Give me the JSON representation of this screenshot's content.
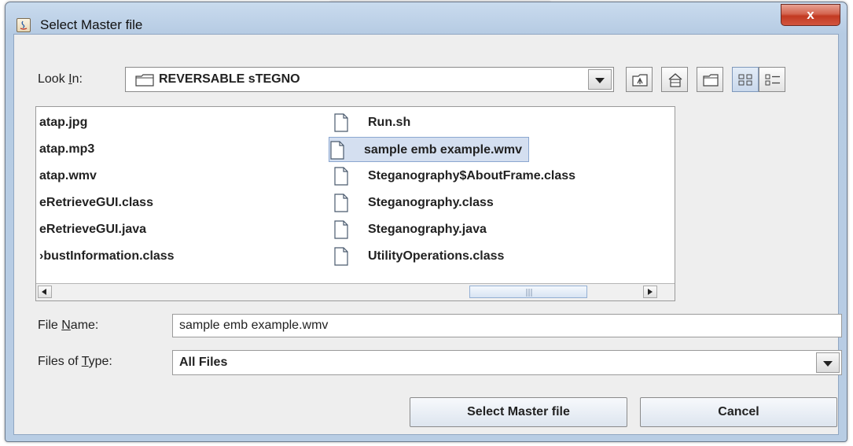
{
  "window": {
    "title": "Select Master file",
    "close_label": "x"
  },
  "look_in": {
    "label_pre": "Look ",
    "label_mnemonic": "I",
    "label_post": "n:",
    "value": "REVERSABLE sTEGNO"
  },
  "toolbar": {
    "buttons": [
      "up-one-level",
      "home",
      "new-folder",
      "list-view",
      "details-view"
    ]
  },
  "files": {
    "left_column": [
      "atap.jpg",
      "atap.mp3",
      "atap.wmv",
      "eRetrieveGUI.class",
      "eRetrieveGUI.java",
      "›bustInformation.class"
    ],
    "right_column": [
      "Run.sh",
      "sample emb example.wmv",
      "Steganography$AboutFrame.class",
      "Steganography.class",
      "Steganography.java",
      "UtilityOperations.class"
    ],
    "selected": "sample emb example.wmv"
  },
  "file_name": {
    "label_pre": "File ",
    "label_mnemonic": "N",
    "label_post": "ame:",
    "value": "sample emb example.wmv"
  },
  "file_type": {
    "label_pre": "Files of ",
    "label_mnemonic": "T",
    "label_post": "ype:",
    "value": "All Files"
  },
  "actions": {
    "approve_label": "Select Master file",
    "cancel_label": "Cancel"
  }
}
